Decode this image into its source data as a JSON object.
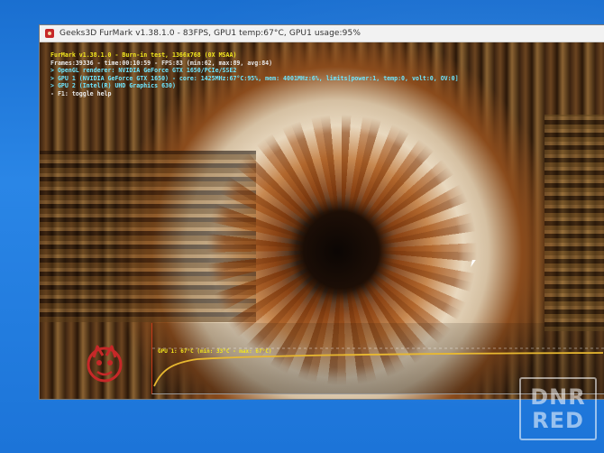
{
  "window": {
    "title": "Geeks3D FurMark v1.38.1.0 - 83FPS, GPU1 temp:67°C, GPU1 usage:95%"
  },
  "hud": {
    "line1": "FurMark v1.38.1.0 - Burn-in test, 1366x768 (0X MSAA)",
    "line2": "Frames:39336 - time:00:10:59 - FPS:83 (min:62, max:89, avg:84)",
    "line3": "> OpenGL renderer: NVIDIA GeForce GTX 1650/PCIe/SSE2",
    "line4": "> GPU 1 (NVIDIA GeForce GTX 1650) - core: 1425MHz:67°C:95%, mem: 4001MHz:6%, limits[power:1, temp:0, volt:0, OV:0]",
    "line5": "> GPU 2 (Intel(R) UHD Graphics 630)",
    "line6": "- F1: toggle help"
  },
  "graph": {
    "label": "GPU 1: 67°C (min: 33°C - max: 67°C)",
    "series_color": "#e8b830"
  },
  "watermark": {
    "line1": "DNR",
    "line2": "RED"
  },
  "colors": {
    "hud_primary": "#f2e61e",
    "hud_info": "#6ee6ff",
    "desktop": "#1c74d8"
  },
  "icons": {
    "app": "furmark-icon",
    "logo": "furmark-logo-icon",
    "cursor": "mouse-cursor-icon"
  }
}
